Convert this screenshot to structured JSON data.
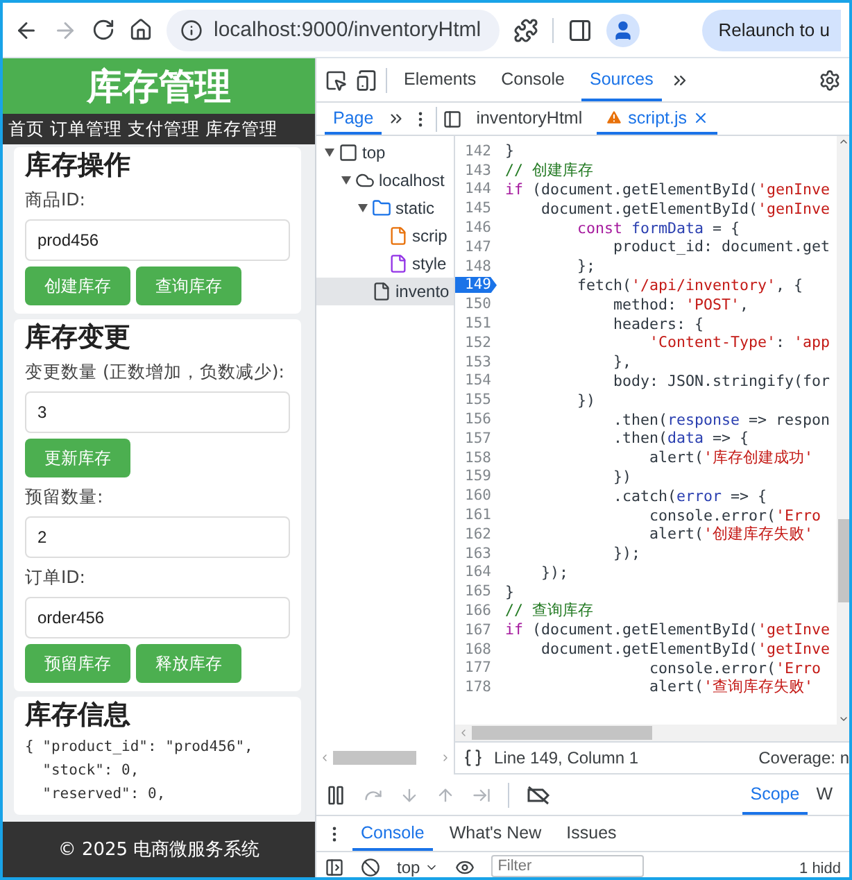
{
  "browser": {
    "back_disabled": false,
    "forward_disabled": true,
    "url": "localhost:9000/inventoryHtml",
    "relaunch": "Relaunch to u"
  },
  "page": {
    "title": "库存管理",
    "nav": [
      "首页",
      "订单管理",
      "支付管理",
      "库存管理"
    ],
    "sections": [
      {
        "heading": "库存操作",
        "items": [
          {
            "kind": "label",
            "text": "商品ID:"
          },
          {
            "kind": "input",
            "value": "prod456"
          },
          {
            "kind": "buttons",
            "labels": [
              "创建库存",
              "查询库存"
            ]
          }
        ]
      },
      {
        "heading": "库存变更",
        "items": [
          {
            "kind": "label",
            "text": "变更数量 (正数增加，负数减少):"
          },
          {
            "kind": "input",
            "value": "3"
          },
          {
            "kind": "buttons",
            "labels": [
              "更新库存"
            ]
          },
          {
            "kind": "label",
            "text": "预留数量:"
          },
          {
            "kind": "input",
            "value": "2"
          },
          {
            "kind": "label",
            "text": "订单ID:"
          },
          {
            "kind": "input",
            "value": "order456"
          },
          {
            "kind": "buttons",
            "labels": [
              "预留库存",
              "释放库存"
            ]
          }
        ]
      },
      {
        "heading": "库存信息",
        "items": [
          {
            "kind": "code",
            "lines": [
              "{ \"product_id\": \"prod456\",",
              "  \"stock\": 0,",
              "  \"reserved\": 0,"
            ]
          }
        ]
      }
    ],
    "footer": "© 2025 电商微服务系统"
  },
  "devtools": {
    "panels": [
      {
        "label": "Elements",
        "selected": false
      },
      {
        "label": "Console",
        "selected": false
      },
      {
        "label": "Sources",
        "selected": true
      }
    ],
    "navigator_tabs": [
      {
        "label": "Page",
        "selected": true
      }
    ],
    "editor_tabs": [
      {
        "label": "inventoryHtml",
        "selected": false,
        "warning": false
      },
      {
        "label": "script.js",
        "selected": true,
        "warning": true
      }
    ],
    "tree": [
      {
        "label": "top",
        "kind": "frame",
        "expanded": true,
        "selected": false,
        "children": [
          {
            "label": "localhost",
            "kind": "origin",
            "expanded": true,
            "selected": false,
            "children": [
              {
                "label": "static",
                "kind": "folder",
                "expanded": true,
                "selected": false,
                "children": [
                  {
                    "label": "scrip",
                    "kind": "script",
                    "selected": false
                  },
                  {
                    "label": "style",
                    "kind": "stylesheet",
                    "selected": false
                  }
                ]
              },
              {
                "label": "invento",
                "kind": "document",
                "selected": true
              }
            ]
          }
        ]
      }
    ],
    "code_lines": [
      {
        "number": "142",
        "breakpoint": false,
        "tokens": [
          {
            "kind": "plain",
            "text": "}"
          }
        ]
      },
      {
        "number": "143",
        "breakpoint": false,
        "tokens": [
          {
            "kind": "comment",
            "text": "// 创建库存"
          }
        ]
      },
      {
        "number": "144",
        "breakpoint": false,
        "tokens": [
          {
            "kind": "keyword",
            "text": "if"
          },
          {
            "kind": "plain",
            "text": " (document.getElementById("
          },
          {
            "kind": "string",
            "text": "'genInve"
          }
        ]
      },
      {
        "number": "145",
        "breakpoint": false,
        "tokens": [
          {
            "kind": "plain",
            "text": "    document.getElementById("
          },
          {
            "kind": "string",
            "text": "'genInve"
          }
        ]
      },
      {
        "number": "146",
        "breakpoint": false,
        "tokens": [
          {
            "kind": "keyword",
            "text": "        const "
          },
          {
            "kind": "variable",
            "text": "formData"
          },
          {
            "kind": "plain",
            "text": " = {"
          }
        ]
      },
      {
        "number": "147",
        "breakpoint": false,
        "tokens": [
          {
            "kind": "plain",
            "text": "            product_id: document.get"
          }
        ]
      },
      {
        "number": "148",
        "breakpoint": false,
        "tokens": [
          {
            "kind": "plain",
            "text": "        };"
          }
        ]
      },
      {
        "number": "149",
        "breakpoint": true,
        "tokens": [
          {
            "kind": "plain",
            "text": "        fetch("
          },
          {
            "kind": "string",
            "text": "'/api/inventory'"
          },
          {
            "kind": "plain",
            "text": ", {"
          }
        ]
      },
      {
        "number": "150",
        "breakpoint": false,
        "tokens": [
          {
            "kind": "plain",
            "text": "            method: "
          },
          {
            "kind": "string",
            "text": "'POST'"
          },
          {
            "kind": "plain",
            "text": ","
          }
        ]
      },
      {
        "number": "151",
        "breakpoint": false,
        "tokens": [
          {
            "kind": "plain",
            "text": "            headers: {"
          }
        ]
      },
      {
        "number": "152",
        "breakpoint": false,
        "tokens": [
          {
            "kind": "string",
            "text": "                'Content-Type'"
          },
          {
            "kind": "plain",
            "text": ": "
          },
          {
            "kind": "string",
            "text": "'app"
          }
        ]
      },
      {
        "number": "153",
        "breakpoint": false,
        "tokens": [
          {
            "kind": "plain",
            "text": "            },"
          }
        ]
      },
      {
        "number": "154",
        "breakpoint": false,
        "tokens": [
          {
            "kind": "plain",
            "text": "            body: JSON.stringify(for"
          }
        ]
      },
      {
        "number": "155",
        "breakpoint": false,
        "tokens": [
          {
            "kind": "plain",
            "text": "        })"
          }
        ]
      },
      {
        "number": "156",
        "breakpoint": false,
        "tokens": [
          {
            "kind": "plain",
            "text": "            .then("
          },
          {
            "kind": "variable",
            "text": "response"
          },
          {
            "kind": "plain",
            "text": " => respon"
          }
        ]
      },
      {
        "number": "157",
        "breakpoint": false,
        "tokens": [
          {
            "kind": "plain",
            "text": "            .then("
          },
          {
            "kind": "variable",
            "text": "data"
          },
          {
            "kind": "plain",
            "text": " => {"
          }
        ]
      },
      {
        "number": "158",
        "breakpoint": false,
        "tokens": [
          {
            "kind": "plain",
            "text": "                alert("
          },
          {
            "kind": "string",
            "text": "'库存创建成功'"
          }
        ]
      },
      {
        "number": "159",
        "breakpoint": false,
        "tokens": [
          {
            "kind": "plain",
            "text": "            })"
          }
        ]
      },
      {
        "number": "160",
        "breakpoint": false,
        "tokens": [
          {
            "kind": "plain",
            "text": "            .catch("
          },
          {
            "kind": "variable",
            "text": "error"
          },
          {
            "kind": "plain",
            "text": " => {"
          }
        ]
      },
      {
        "number": "161",
        "breakpoint": false,
        "tokens": [
          {
            "kind": "plain",
            "text": "                console.error("
          },
          {
            "kind": "string",
            "text": "'Erro"
          }
        ]
      },
      {
        "number": "162",
        "breakpoint": false,
        "tokens": [
          {
            "kind": "plain",
            "text": "                alert("
          },
          {
            "kind": "string",
            "text": "'创建库存失败'"
          }
        ]
      },
      {
        "number": "163",
        "breakpoint": false,
        "tokens": [
          {
            "kind": "plain",
            "text": "            });"
          }
        ]
      },
      {
        "number": "164",
        "breakpoint": false,
        "tokens": [
          {
            "kind": "plain",
            "text": "    });"
          }
        ]
      },
      {
        "number": "165",
        "breakpoint": false,
        "tokens": [
          {
            "kind": "plain",
            "text": "}"
          }
        ]
      },
      {
        "number": "166",
        "breakpoint": false,
        "tokens": [
          {
            "kind": "comment",
            "text": "// 查询库存"
          }
        ]
      },
      {
        "number": "167",
        "breakpoint": false,
        "tokens": [
          {
            "kind": "keyword",
            "text": "if"
          },
          {
            "kind": "plain",
            "text": " (document.getElementById("
          },
          {
            "kind": "string",
            "text": "'getInve"
          }
        ]
      },
      {
        "number": "168",
        "breakpoint": false,
        "tokens": [
          {
            "kind": "plain",
            "text": "    document.getElementById("
          },
          {
            "kind": "string",
            "text": "'getInve"
          }
        ]
      },
      {
        "number": "177",
        "breakpoint": false,
        "tokens": [
          {
            "kind": "plain",
            "text": "                console.error("
          },
          {
            "kind": "string",
            "text": "'Erro"
          }
        ]
      },
      {
        "number": "178",
        "breakpoint": false,
        "tokens": [
          {
            "kind": "plain",
            "text": "                alert("
          },
          {
            "kind": "string",
            "text": "'查询库存失败'"
          }
        ]
      }
    ],
    "status": {
      "cursor": "Line 149, Column 1",
      "coverage": "Coverage: n"
    },
    "sidebar_tabs": [
      {
        "label": "Scope",
        "selected": true
      },
      {
        "label": "W",
        "selected": false
      }
    ],
    "drawer_tabs": [
      {
        "label": "Console",
        "selected": true
      },
      {
        "label": "What's New",
        "selected": false
      },
      {
        "label": "Issues",
        "selected": false
      }
    ],
    "console_toolbar": {
      "context": "top",
      "filter_placeholder": "Filter",
      "hidden": "1 hidd"
    }
  }
}
